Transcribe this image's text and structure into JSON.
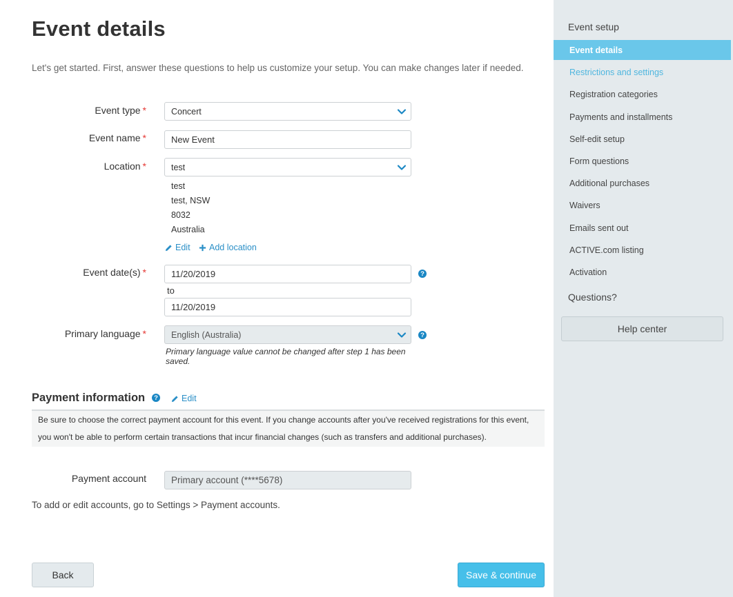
{
  "page": {
    "title": "Event details",
    "intro": "Let's get started. First, answer these questions to help us customize your setup. You can make changes later if needed."
  },
  "form": {
    "required_marker": "*",
    "event_type": {
      "label": "Event type",
      "value": "Concert"
    },
    "event_name": {
      "label": "Event name",
      "value": "New Event"
    },
    "location": {
      "label": "Location",
      "value": "test",
      "address_lines": [
        "test",
        "test, NSW",
        "8032",
        "Australia"
      ],
      "edit_label": "Edit",
      "add_label": "Add location"
    },
    "event_dates": {
      "label": "Event date(s)",
      "start": "11/20/2019",
      "to_label": "to",
      "end": "11/20/2019"
    },
    "primary_language": {
      "label": "Primary language",
      "value": "English (Australia)",
      "note": "Primary language value cannot be changed after step 1 has been saved."
    },
    "help_glyph": "?"
  },
  "payment": {
    "title": "Payment information",
    "edit_label": "Edit",
    "info": "Be sure to choose the correct payment account for this event. If you change accounts after you've received registrations for this event, you won't be able to perform certain transactions that incur financial changes (such as transfers and additional purchases).",
    "account_label": "Payment account",
    "account_value": "Primary account (****5678)",
    "footer_note": "To add or edit accounts, go to Settings > Payment accounts."
  },
  "buttons": {
    "back": "Back",
    "save": "Save & continue"
  },
  "sidebar": {
    "heading": "Event setup",
    "items": [
      {
        "label": "Event details",
        "state": "active"
      },
      {
        "label": "Restrictions and settings",
        "state": "visited"
      },
      {
        "label": "Registration categories",
        "state": "normal"
      },
      {
        "label": "Payments and installments",
        "state": "normal"
      },
      {
        "label": "Self-edit setup",
        "state": "normal"
      },
      {
        "label": "Form questions",
        "state": "normal"
      },
      {
        "label": "Additional purchases",
        "state": "normal"
      },
      {
        "label": "Waivers",
        "state": "normal"
      },
      {
        "label": "Emails sent out",
        "state": "normal"
      },
      {
        "label": "ACTIVE.com listing",
        "state": "normal"
      },
      {
        "label": "Activation",
        "state": "normal"
      }
    ],
    "questions_heading": "Questions?",
    "help_center": "Help center"
  },
  "colors": {
    "accent": "#46bfe9",
    "link": "#2a8fc7",
    "sidebar_bg": "#e4eaed",
    "active_item": "#6ac7ea",
    "required": "#e53935"
  },
  "icons": {
    "dropdown": "chevron-down-icon",
    "help": "question-circle-icon",
    "edit": "pencil-icon",
    "add": "plus-icon"
  }
}
